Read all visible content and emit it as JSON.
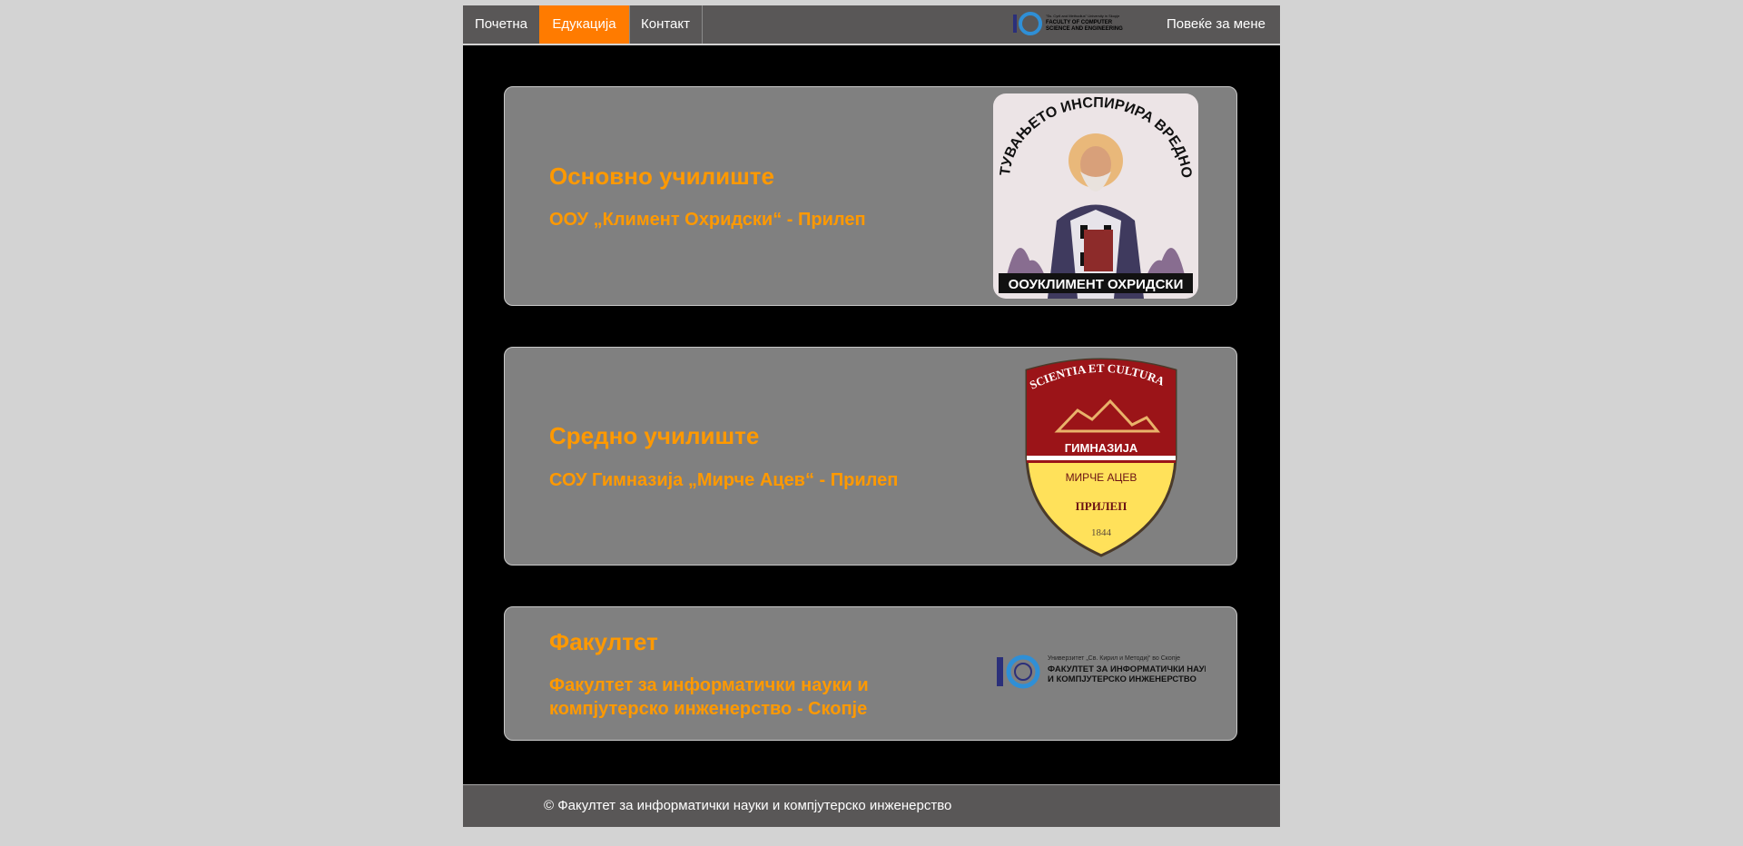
{
  "nav": {
    "items": [
      {
        "label": "Почетна"
      },
      {
        "label": "Едукација"
      },
      {
        "label": "Контакт"
      }
    ],
    "right_label": "Повеќе за мене",
    "logo_text_small": "\"Ss. Cyril and Methodius\" University in Skopje",
    "logo_text_line1": "FACULTY OF COMPUTER",
    "logo_text_line2": "SCIENCE AND ENGINEERING"
  },
  "cards": [
    {
      "title": "Основно училиште",
      "subtitle": "ООУ „Климент Охридски“ - Прилеп",
      "img_top_text": "ТУВАЊЕТО ИНСПИРИРА ВРЕДНО",
      "img_bottom_text": "ООУКЛИМЕНТ ОХРИДСКИ"
    },
    {
      "title": "Средно училиште",
      "subtitle": "СОУ Гимназија „Мирче Ацев“ - Прилеп",
      "crest_top": "SCIENTIA ET CULTURA",
      "crest_line1": "ГИМНАЗИЈА",
      "crest_line2": "МИРЧЕ АЦЕВ",
      "crest_line3": "ПРИЛЕП",
      "crest_year": "1844"
    },
    {
      "title": "Факултет",
      "subtitle_line1": "Факултет за информатички науки и",
      "subtitle_line2": "компјутерско инженерство - Скопје",
      "logo_small": "Универзитет „Св. Кирил и Методиј“ во Скопје",
      "logo_line1": "ФАКУЛТЕТ ЗА ИНФОРМАТИЧКИ НАУКИ",
      "logo_line2": "И КОМПЈУТЕРСКО ИНЖЕНЕРСТВО"
    }
  ],
  "footer": {
    "text": "© Факултет за информатички науки и компјутерско инженерство"
  },
  "colors": {
    "accent": "#ff7b00",
    "heading": "#ff9900",
    "nav_bg": "#595757",
    "card_bg": "#808080"
  }
}
